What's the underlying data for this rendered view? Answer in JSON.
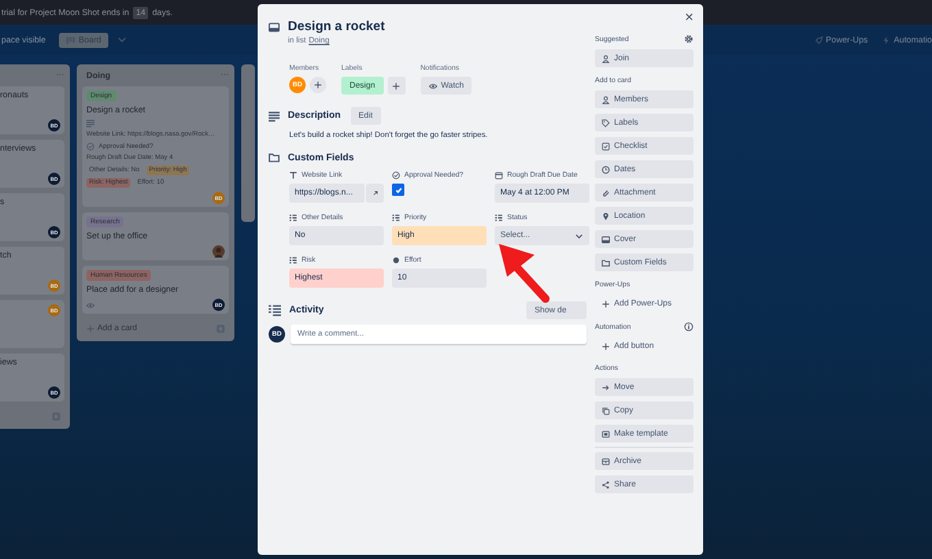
{
  "banner": {
    "before": "trial for Project Moon Shot ends in",
    "count": "14",
    "after": "days."
  },
  "board_header": {
    "visibility": "pace visible",
    "view": "Board",
    "actions": [
      "Power-Ups",
      "Automatio"
    ]
  },
  "lists": [
    {
      "menu": "···",
      "cards": [
        {
          "title": "ronauts",
          "avatar": {
            "initials": "BD",
            "color": "#0e1b33"
          }
        },
        {
          "title": "nterviews",
          "avatar": {
            "initials": "BD",
            "color": "#0e1b33"
          }
        },
        {
          "title": "s",
          "avatar": {
            "initials": "BD",
            "color": "#0e1b33"
          }
        },
        {
          "title": "tch",
          "avatar": {
            "initials": "BD",
            "color": "#a86a12"
          }
        },
        {
          "avatar": {
            "initials": "BD",
            "color": "#a86a12"
          }
        },
        {
          "title": "iews",
          "avatar": {
            "initials": "BD",
            "color": "#0e1b33"
          }
        }
      ]
    },
    {
      "title": "Doing",
      "menu": "···",
      "cards": [
        {
          "labels": [
            {
              "text": "Design",
              "color": "#5f8a6e"
            }
          ],
          "title": "Design a rocket",
          "description_icon": true,
          "lines": [
            "Website Link: https://blogs.nasa.gov/Rock…"
          ],
          "approval": "Approval Needed?",
          "date_line": "Rough Draft Due Date: May 4",
          "badges": [
            {
              "text": "Other Details: No"
            },
            {
              "text": "Priority: High",
              "color": "#8e7654"
            },
            {
              "text": "Risk: Highest",
              "color": "#8e6462"
            },
            {
              "text": "Effort: 10"
            }
          ],
          "avatar": {
            "initials": "BD",
            "color": "#a86a12"
          }
        },
        {
          "labels": [
            {
              "text": "Research",
              "color": "#77728e"
            }
          ],
          "title": "Set up the office",
          "avatar": {
            "kind": "photo",
            "color": "#5a3a2c"
          }
        },
        {
          "labels": [
            {
              "text": "Human Resources",
              "color": "#8e6462"
            }
          ],
          "title": "Place add for a designer",
          "watch_icon": true,
          "avatar": {
            "initials": "BD",
            "color": "#0e1b33"
          }
        }
      ],
      "add": "Add a card"
    }
  ],
  "card_dialog": {
    "close": "×",
    "title": "Design a rocket",
    "list_prefix": "in list",
    "list_name": "Doing",
    "members": {
      "heading": "Members",
      "avatar": {
        "initials": "BD",
        "color": "#ff8b00"
      }
    },
    "labels": {
      "heading": "Labels",
      "items": [
        {
          "text": "Design",
          "color": "#b3f0d0"
        }
      ]
    },
    "notifications": {
      "heading": "Notifications",
      "button": "Watch"
    },
    "description": {
      "heading": "Description",
      "edit": "Edit",
      "text": "Let's build a rocket ship! Don't forget the go faster stripes."
    },
    "custom_fields": {
      "heading": "Custom Fields",
      "fields": [
        {
          "kind": "link",
          "label": "Website Link",
          "value": "https://blogs.n..."
        },
        {
          "kind": "checkbox",
          "label": "Approval Needed?",
          "checked": true
        },
        {
          "kind": "date",
          "label": "Rough Draft Due Date",
          "value": "May 4 at 12:00 PM"
        },
        {
          "kind": "dropdown",
          "label": "Other Details",
          "value": "No"
        },
        {
          "kind": "dropdown",
          "label": "Priority",
          "value": "High",
          "color": "#ffdfb8"
        },
        {
          "kind": "select",
          "label": "Status",
          "placeholder": "Select..."
        },
        {
          "kind": "dropdown",
          "label": "Risk",
          "value": "Highest",
          "color": "#ffd0cc"
        },
        {
          "kind": "number",
          "label": "Effort",
          "value": "10"
        }
      ]
    },
    "activity": {
      "heading": "Activity",
      "button": "Show de",
      "avatar": {
        "initials": "BD",
        "color": "#172b4d"
      },
      "placeholder": "Write a comment..."
    },
    "sidebar": [
      {
        "heading": "Suggested",
        "settings": true,
        "items": [
          {
            "kind": "button",
            "label": "Join"
          }
        ]
      },
      {
        "heading": "Add to card",
        "items": [
          {
            "kind": "button",
            "label": "Members"
          },
          {
            "kind": "button",
            "label": "Labels"
          },
          {
            "kind": "button",
            "label": "Checklist"
          },
          {
            "kind": "button",
            "label": "Dates"
          },
          {
            "kind": "button",
            "label": "Attachment"
          },
          {
            "kind": "button",
            "label": "Location"
          },
          {
            "kind": "button",
            "label": "Cover"
          },
          {
            "kind": "button",
            "label": "Custom Fields"
          }
        ]
      },
      {
        "heading": "Power-Ups",
        "items": [
          {
            "kind": "add",
            "label": "Add Power-Ups"
          }
        ]
      },
      {
        "heading": "Automation",
        "info": true,
        "items": [
          {
            "kind": "add",
            "label": "Add button"
          }
        ]
      },
      {
        "heading": "Actions",
        "items": [
          {
            "kind": "button",
            "label": "Move"
          },
          {
            "kind": "button",
            "label": "Copy"
          },
          {
            "kind": "button",
            "label": "Make template"
          },
          {
            "kind": "divider"
          },
          {
            "kind": "button",
            "label": "Archive"
          },
          {
            "kind": "button",
            "label": "Share"
          }
        ]
      }
    ]
  }
}
